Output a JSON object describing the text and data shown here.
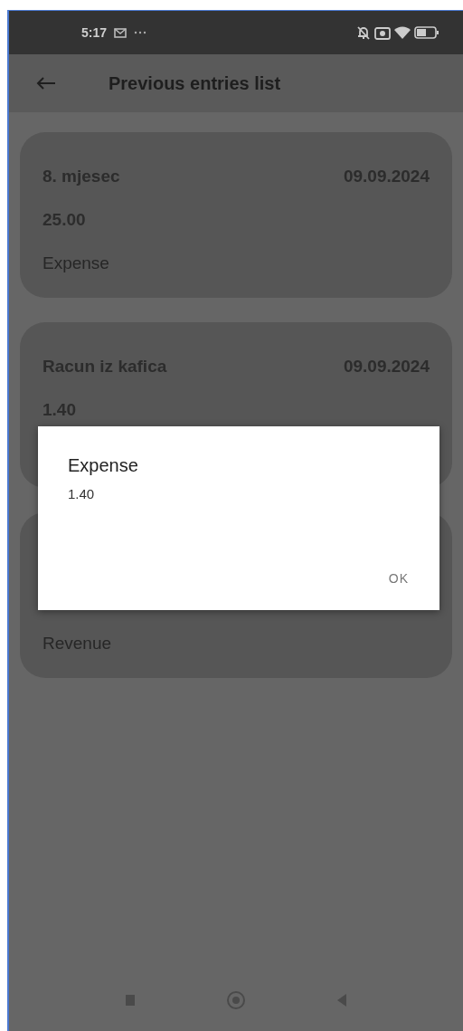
{
  "status_bar": {
    "time": "5:17"
  },
  "app_bar": {
    "title": "Previous entries list"
  },
  "entries": [
    {
      "title": "8. mjesec",
      "date": "09.09.2024",
      "amount": "25.00",
      "type": "Expense"
    },
    {
      "title": "Racun iz kafica",
      "date": "09.09.2024",
      "amount": "1.40"
    },
    {
      "type": "Revenue"
    }
  ],
  "dialog": {
    "title": "Expense",
    "message": "1.40",
    "buttons": [
      "OK"
    ]
  }
}
